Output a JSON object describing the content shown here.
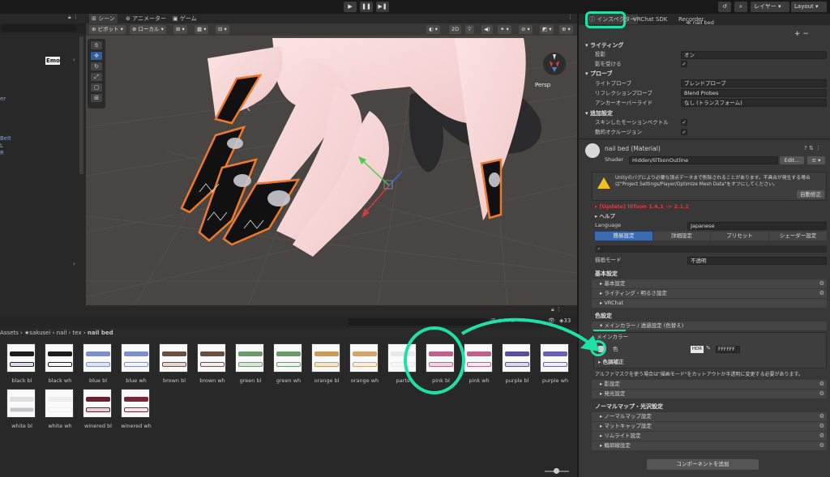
{
  "toolbar": {
    "play": "▶",
    "pause": "❚❚",
    "step": "▶❚",
    "history": "↺",
    "search": "⌕",
    "layers": "レイヤー",
    "layout": "Layout"
  },
  "hierarchy": {
    "items": [
      "Emo",
      "er",
      "Belt",
      "L",
      "R"
    ]
  },
  "scene": {
    "tabs": [
      "シーン",
      "アニメーター",
      "ゲーム"
    ],
    "pivot": "ピボット",
    "local": "ローカル",
    "mode_2d": "2D",
    "persp": "Persp"
  },
  "project": {
    "breadcrumb": [
      "Assets",
      "★sakusei",
      "nail",
      "tex",
      "nail bed"
    ],
    "count": "33",
    "assets": [
      {
        "label": "black bl",
        "color": "#1c1c1c",
        "color2": "#d8dce8"
      },
      {
        "label": "black wh",
        "color": "#1c1c1c",
        "color2": "#f4f4f4"
      },
      {
        "label": "blue bl",
        "color": "#7b8fc8",
        "color2": "#dfe3f2"
      },
      {
        "label": "blue wh",
        "color": "#7b8fc8",
        "color2": "#f2f4fa"
      },
      {
        "label": "brown bl",
        "color": "#6c4e3e",
        "color2": "#e2d9d4"
      },
      {
        "label": "brown wh",
        "color": "#6c4e3e",
        "color2": "#f3efec"
      },
      {
        "label": "green bl",
        "color": "#6d9a6a",
        "color2": "#dbe6da"
      },
      {
        "label": "green wh",
        "color": "#6d9a6a",
        "color2": "#eef4ed"
      },
      {
        "label": "orange bl",
        "color": "#c99a5a",
        "color2": "#f0e4d2"
      },
      {
        "label": "orange wh",
        "color": "#d4a468",
        "color2": "#f6eee2"
      },
      {
        "label": "parts",
        "color": "#e8e8e8",
        "color2": "#f6f6f6"
      },
      {
        "label": "pink bl",
        "color": "#c0608c",
        "color2": "#ecd6e0"
      },
      {
        "label": "pink wh",
        "color": "#c0608c",
        "color2": "#f6eaf0"
      },
      {
        "label": "purple bl",
        "color": "#5a4f9a",
        "color2": "#dcd9ec"
      },
      {
        "label": "purple wh",
        "color": "#6a5fb0",
        "color2": "#eeecf8"
      },
      {
        "label": "white bl",
        "color": "#e0e0e0",
        "color2": "#c4c4d0"
      },
      {
        "label": "white wh",
        "color": "#eeeeee",
        "color2": "#fafafa"
      },
      {
        "label": "winered bl",
        "color": "#6a2030",
        "color2": "#e2d0d4"
      },
      {
        "label": "winered wh",
        "color": "#7a2838",
        "color2": "#f2e6e8"
      }
    ]
  },
  "inspector": {
    "tabs": [
      "インスペクター",
      "VRChat SDK",
      "Recorder"
    ],
    "top_field": "nail bed",
    "lighting_header": "ライティング",
    "cast_shadows_label": "投影",
    "cast_shadows_value": "オン",
    "receive_shadows_label": "影を受ける",
    "probes_header": "プローブ",
    "light_probes_label": "ライトプローブ",
    "light_probes_value": "ブレンドプローブ",
    "reflection_probes_label": "リフレクションプローブ",
    "reflection_probes_value": "Blend Probes",
    "anchor_label": "アンカーオーバーライド",
    "anchor_value": "なし (トランスフォーム)",
    "additional_header": "追加設定",
    "skinned_motion_label": "スキンしたモーションベクトル",
    "dynamic_occlusion_label": "動的オクルージョン",
    "material_name": "nail bed (Material)",
    "shader_label": "Shader",
    "shader_value": "Hidden/lilToonOutline",
    "edit_button": "Edit...",
    "warning_text": "Unityのバグにより必要な頂点データまで削除されることがあります。不具合が発生する場合は\"Project Settings/Player/Optimize Mesh Data\"をオフにしてください。",
    "auto_fix_button": "自動修正",
    "update_text": "[Update] lilToon 1.4.1 -> 2.1.1",
    "help_label": "ヘルプ",
    "language_label": "Language",
    "language_value": "Japanese",
    "mode_tabs": [
      "簡易設定",
      "詳細設定",
      "プリセット",
      "シェーダー設定"
    ],
    "render_mode_label": "描画モード",
    "render_mode_value": "不透明",
    "basic_header": "基本設定",
    "basic_folds": [
      "基本設定",
      "ライティング・明るさ設定",
      "VRChat"
    ],
    "color_header": "色設定",
    "main_color_fold": "メインカラー / 透過設定 (色替え)",
    "main_color_label": "メインカラー",
    "color_label": "色",
    "hdr_label": "HDR",
    "hex_value": "FFFFFF",
    "tone_correction": "色調補正",
    "alpha_note": "アルファマスクを使う場合は\"描画モード\"をカットアウトか半透明に変更する必要があります。",
    "shadow_folds": [
      "影設定",
      "発光設定"
    ],
    "normal_header": "ノーマルマップ・光沢設定",
    "normal_folds": [
      "ノーマルマップ設定",
      "マットキャップ設定",
      "リムライト設定",
      "輪郭線設定"
    ],
    "add_component": "コンポーネントを追加"
  },
  "colors": {
    "accent": "#1fe0a9",
    "outline": "#f07a2a",
    "active_tab": "#3a6bb0"
  }
}
